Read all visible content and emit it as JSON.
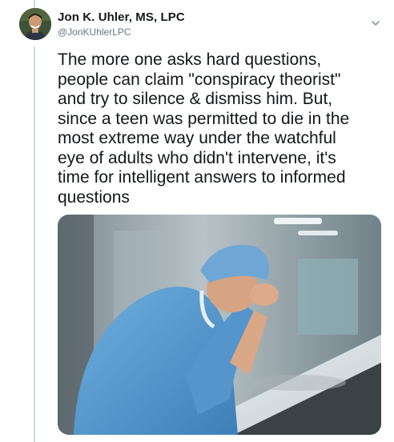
{
  "tweet": {
    "author_name": "Jon K. Uhler, MS, LPC",
    "author_handle": "@JonKUhlerLPC",
    "text": "The more one asks hard questions,\npeople can claim \"conspiracy theorist\"\nand try to silence & dismiss him. But,\nsince a teen was permitted to die in the\nmost extreme way under the watchful\neye of adults who didn't intervene, it's\ntime for intelligent answers to informed\nquestions",
    "menu_icon": "chevron-down-icon",
    "media_description_icon": "photo"
  },
  "colors": {
    "name_text": "#14171a",
    "handle_text": "#657786",
    "thread_line": "#cfd9de",
    "scrubs_blue": "#5b9bd1"
  }
}
